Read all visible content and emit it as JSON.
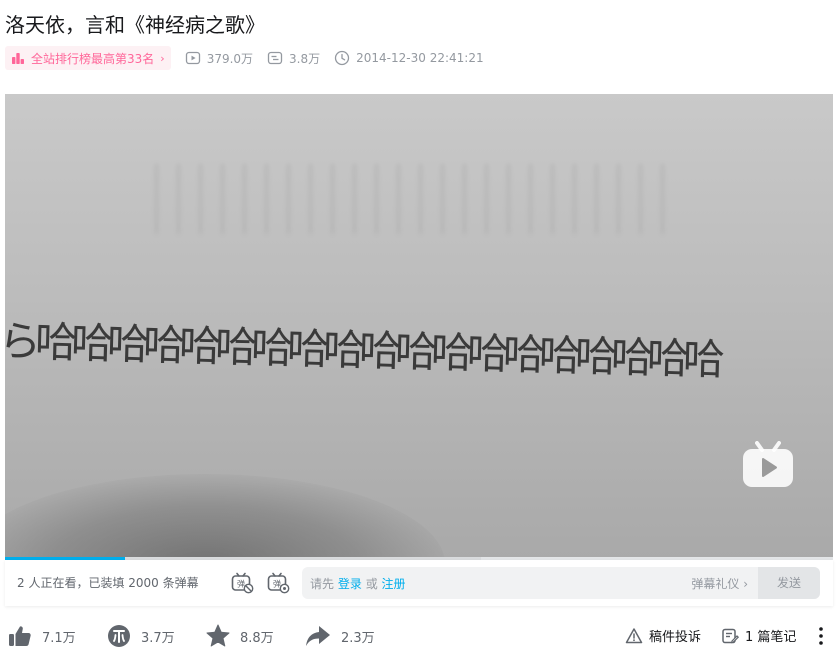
{
  "video": {
    "title": "洛天依，言和《神经病之歌》"
  },
  "meta": {
    "rank_label": "全站排行榜最高第33名",
    "views": "379.0万",
    "danmaku_count": "3.8万",
    "publish_time": "2014-12-30 22:41:21"
  },
  "player": {
    "frame_text": "ら哈哈哈哈哈哈哈哈哈哈哈哈哈哈哈哈哈哈哈",
    "played_fraction": 0.145,
    "buffered_fraction": 0.575,
    "logo_icon": "bilibili-tv-icon"
  },
  "danmaku": {
    "viewers_text": "2 人正在看，已装填 2000 条弹幕",
    "toggle_icon": "danmaku-toggle-icon",
    "settings_icon": "danmaku-settings-icon",
    "prompt_prefix": "请先",
    "login_link": "登录",
    "or_text": "或",
    "register_link": "注册",
    "gift_label": "弹幕礼仪 ›",
    "send_label": "发送"
  },
  "actions": {
    "like_count": "7.1万",
    "coin_count": "3.7万",
    "favorite_count": "8.8万",
    "share_count": "2.3万",
    "report_label": "稿件投诉",
    "notes_label": "1 篇笔记"
  },
  "colors": {
    "accent": "#00aeec",
    "rank_pink": "#ff6699",
    "rank_bg": "#fdf1f4",
    "icon_gray": "#61666d"
  }
}
